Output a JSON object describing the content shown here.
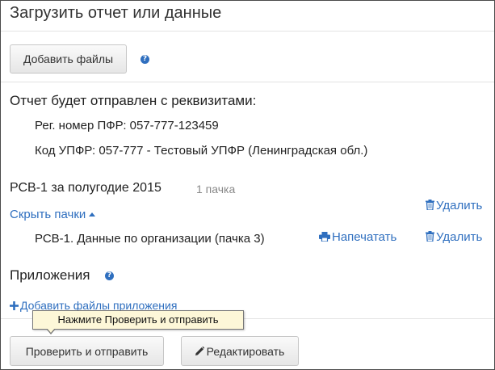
{
  "dialog": {
    "title": "Загрузить отчет или данные"
  },
  "upload": {
    "add_files_label": "Добавить файлы",
    "help_icon": "question-circle-icon"
  },
  "requisites": {
    "heading": "Отчет будет отправлен с реквизитами:",
    "reg_number": "Рег. номер ПФР: 057-777-123459",
    "upfr_code": "Код УПФР: 057-777 - Тестовый УПФР (Ленинградская обл.)"
  },
  "report": {
    "title": "РСВ-1 за полугодие 2015",
    "pack_count": "1 пачка",
    "delete_label": "Удалить",
    "hide_packs_label": "Скрыть пачки",
    "packs": [
      {
        "name": "РСВ-1. Данные по организации (пачка 3)",
        "print_label": "Напечатать",
        "delete_label": "Удалить"
      }
    ]
  },
  "attachments": {
    "heading": "Приложения",
    "add_link_label": "Добавить файлы приложения"
  },
  "tooltip": {
    "text": "Нажмите Проверить и отправить"
  },
  "footer": {
    "check_send_label": "Проверить и отправить",
    "edit_label": "Редактировать"
  },
  "colors": {
    "link": "#2f6fbf",
    "tooltip_bg": "#fdf7d8"
  }
}
